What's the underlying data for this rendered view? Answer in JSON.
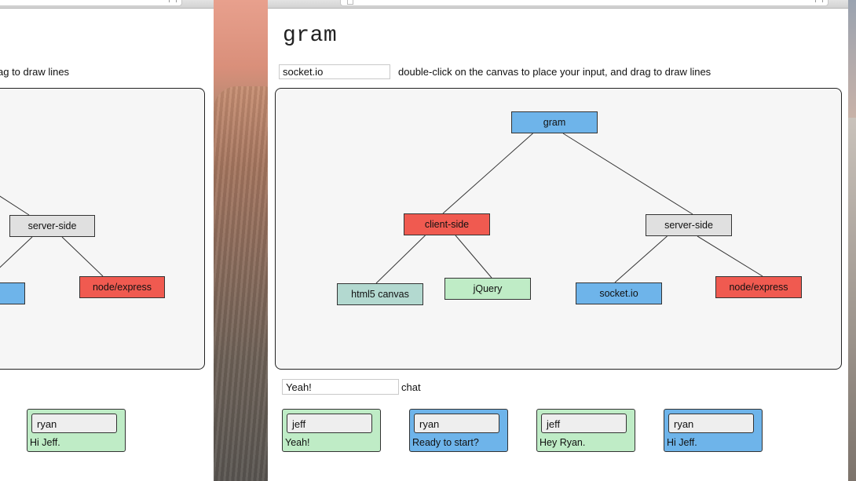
{
  "colors": {
    "blue": "#6eb4ea",
    "red": "#f05a50",
    "grey": "#e0e0e0",
    "teal": "#b3d9d0",
    "green": "#bfecc6"
  },
  "left_window": {
    "hint_text": "ag to draw lines",
    "nodes": [
      {
        "label": "server-side",
        "color": "grey"
      },
      {
        "label": "node/express",
        "color": "red"
      },
      {
        "label": "",
        "color": "blue"
      }
    ],
    "messages": [
      {
        "user": "ryan",
        "text": "Hi Jeff.",
        "color": "green"
      }
    ]
  },
  "right_window": {
    "title": "gram",
    "node_input_value": "socket.io",
    "hint_text": "double-click on the canvas to place your input, and drag to draw lines",
    "nodes": [
      {
        "id": "gram",
        "label": "gram",
        "color": "blue"
      },
      {
        "id": "client",
        "label": "client-side",
        "color": "red"
      },
      {
        "id": "server",
        "label": "server-side",
        "color": "grey"
      },
      {
        "id": "canvas",
        "label": "html5 canvas",
        "color": "teal"
      },
      {
        "id": "jquery",
        "label": "jQuery",
        "color": "green"
      },
      {
        "id": "socket",
        "label": "socket.io",
        "color": "blue"
      },
      {
        "id": "express",
        "label": "node/express",
        "color": "red"
      }
    ],
    "edges": [
      [
        "gram",
        "client"
      ],
      [
        "gram",
        "server"
      ],
      [
        "client",
        "canvas"
      ],
      [
        "client",
        "jquery"
      ],
      [
        "server",
        "socket"
      ],
      [
        "server",
        "express"
      ]
    ],
    "chat_input_value": "Yeah!",
    "chat_label": "chat",
    "messages": [
      {
        "user": "jeff",
        "text": "Yeah!",
        "color": "green"
      },
      {
        "user": "ryan",
        "text": "Ready to start?",
        "color": "blue"
      },
      {
        "user": "jeff",
        "text": "Hey Ryan.",
        "color": "green"
      },
      {
        "user": "ryan",
        "text": "Hi Jeff.",
        "color": "blue"
      }
    ]
  }
}
